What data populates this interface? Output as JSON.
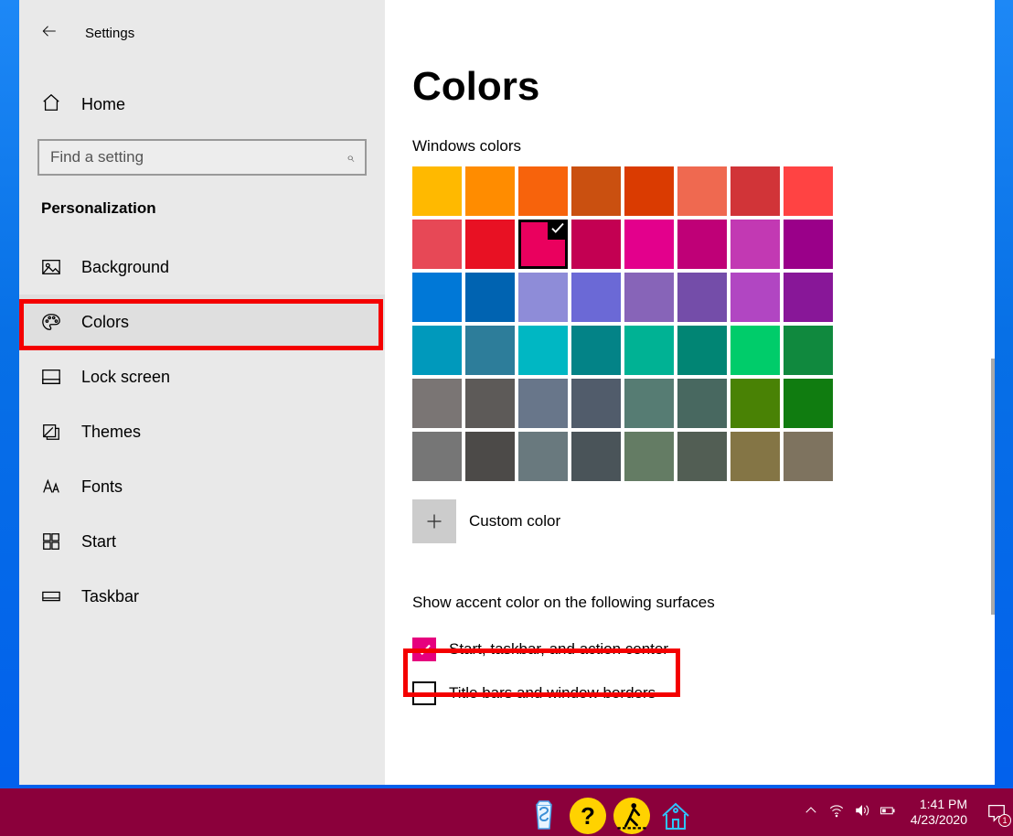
{
  "window": {
    "title": "Settings"
  },
  "sidebar": {
    "home": "Home",
    "search_placeholder": "Find a setting",
    "category": "Personalization",
    "items": [
      {
        "label": "Background"
      },
      {
        "label": "Colors"
      },
      {
        "label": "Lock screen"
      },
      {
        "label": "Themes"
      },
      {
        "label": "Fonts"
      },
      {
        "label": "Start"
      },
      {
        "label": "Taskbar"
      }
    ]
  },
  "content": {
    "heading": "Colors",
    "windows_colors_label": "Windows colors",
    "selected_color_index": 10,
    "colors": [
      "#ffb900",
      "#ff8c00",
      "#f7630c",
      "#ca5010",
      "#da3b01",
      "#ef6950",
      "#d13438",
      "#ff4343",
      "#e74856",
      "#e81123",
      "#ea005e",
      "#c30052",
      "#e3008c",
      "#bf0077",
      "#c239b3",
      "#9a0089",
      "#0078d7",
      "#0063b1",
      "#8e8cd8",
      "#6b69d6",
      "#8764b8",
      "#744da9",
      "#b146c2",
      "#881798",
      "#0099bc",
      "#2d7d9a",
      "#00b7c3",
      "#038387",
      "#00b294",
      "#018574",
      "#00cc6a",
      "#10893e",
      "#7a7574",
      "#5d5a58",
      "#68768a",
      "#515c6b",
      "#567c73",
      "#486860",
      "#498205",
      "#107c10",
      "#767676",
      "#4c4a48",
      "#69797e",
      "#4a5459",
      "#647c64",
      "#525e54",
      "#847545",
      "#7e735f"
    ],
    "custom_color_label": "Custom color",
    "accent_surfaces_label": "Show accent color on the following surfaces",
    "checkboxes": [
      {
        "label": "Start, taskbar, and action center",
        "checked": true
      },
      {
        "label": "Title bars and window borders",
        "checked": false
      }
    ]
  },
  "taskbar": {
    "time": "1:41 PM",
    "date": "4/23/2020",
    "notif_count": "1"
  }
}
